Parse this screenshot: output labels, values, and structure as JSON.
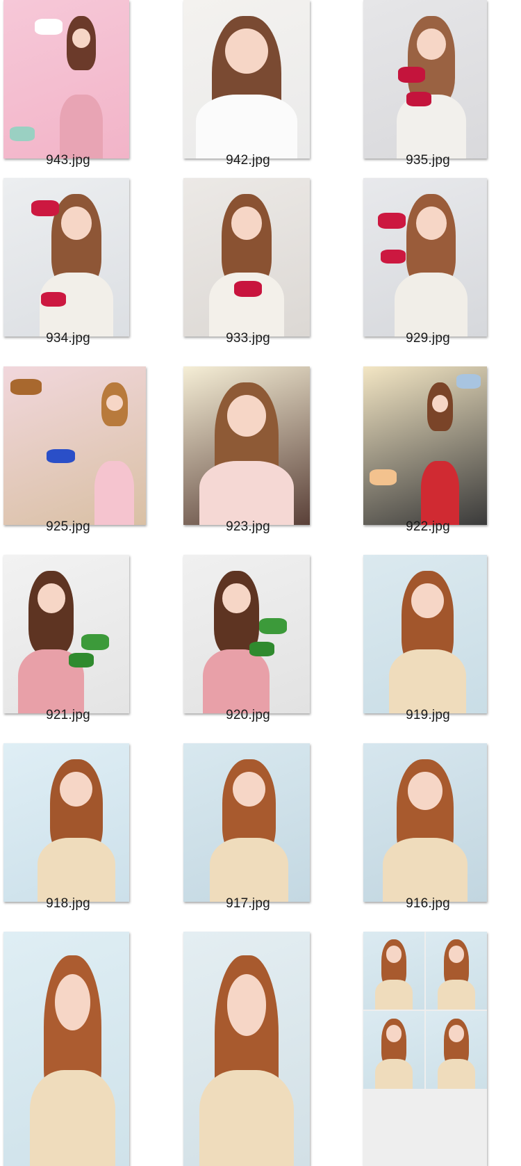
{
  "files": [
    {
      "name": "943.jpg",
      "icon": "photo-thumbnail-icon",
      "bg": "#f6c8d8",
      "bg2": "#f2b4c8",
      "hair": "#6b3a2a",
      "top": "#e8a4b4",
      "prop": "#ffffff",
      "prop2": "#9ad0c2"
    },
    {
      "name": "942.jpg",
      "icon": "photo-thumbnail-icon",
      "bg": "#f4f2ef",
      "bg2": "#eaeaea",
      "hair": "#7a4a32",
      "top": "#fbfbfb",
      "prop": "#f1d3c3",
      "prop2": "#f1d3c3"
    },
    {
      "name": "935.jpg",
      "icon": "photo-thumbnail-icon",
      "bg": "#e6e6e8",
      "bg2": "#d9d9dc",
      "hair": "#9a6242",
      "top": "#f2f0ec",
      "prop": "#c4143c",
      "prop2": "#c4143c"
    },
    {
      "name": "934.jpg",
      "icon": "photo-thumbnail-icon",
      "bg": "#eceef0",
      "bg2": "#dcdfe3",
      "hair": "#8e5636",
      "top": "#f2efe9",
      "prop": "#cc1840",
      "prop2": "#cc1840"
    },
    {
      "name": "933.jpg",
      "icon": "photo-thumbnail-icon",
      "bg": "#ece9e6",
      "bg2": "#dcd8d4",
      "hair": "#8a5232",
      "top": "#f3f0ea",
      "prop": "#c8143e",
      "prop2": "#c8143e"
    },
    {
      "name": "929.jpg",
      "icon": "photo-thumbnail-icon",
      "bg": "#e8e9ec",
      "bg2": "#d6d8dc",
      "hair": "#9a5c3a",
      "top": "#f1eee8",
      "prop": "#cc1840",
      "prop2": "#cc1840"
    },
    {
      "name": "925.jpg",
      "icon": "photo-thumbnail-icon",
      "bg": "#f1d7dc",
      "bg2": "#d9c0a4",
      "hair": "#b87a3c",
      "top": "#f5c4cf",
      "prop": "#a8682e",
      "prop2": "#2a4fc8"
    },
    {
      "name": "923.jpg",
      "icon": "photo-thumbnail-icon",
      "bg": "#f5eed6",
      "bg2": "#5a4038",
      "hair": "#8e5a36",
      "top": "#f5d8d4",
      "prop": "#f8e6e2",
      "prop2": "#f8e6e2"
    },
    {
      "name": "922.jpg",
      "icon": "photo-thumbnail-icon",
      "bg": "#f3e6c4",
      "bg2": "#3a3a3a",
      "hair": "#7a4428",
      "top": "#d02a32",
      "prop": "#f3c28e",
      "prop2": "#a8c4e0"
    },
    {
      "name": "921.jpg",
      "icon": "photo-thumbnail-icon",
      "bg": "#f2f2f2",
      "bg2": "#e4e4e4",
      "hair": "#5e3422",
      "top": "#e8a0a8",
      "prop": "#3c9a3a",
      "prop2": "#2f8a2e"
    },
    {
      "name": "920.jpg",
      "icon": "photo-thumbnail-icon",
      "bg": "#f0f0f0",
      "bg2": "#e2e2e2",
      "hair": "#5e3422",
      "top": "#e8a0a8",
      "prop": "#3c9a3a",
      "prop2": "#2f8a2e"
    },
    {
      "name": "919.jpg",
      "icon": "photo-thumbnail-icon",
      "bg": "#dbe9ef",
      "bg2": "#c9dde6",
      "hair": "#a2562c",
      "top": "#efdcbc",
      "prop": "#efdcbc",
      "prop2": "#efdcbc"
    },
    {
      "name": "918.jpg",
      "icon": "photo-thumbnail-icon",
      "bg": "#dfeef5",
      "bg2": "#cce0ea",
      "hair": "#a2562c",
      "top": "#efdcbc",
      "prop": "#efdcbc",
      "prop2": "#efdcbc"
    },
    {
      "name": "917.jpg",
      "icon": "photo-thumbnail-icon",
      "bg": "#d8e8ef",
      "bg2": "#c4d8e2",
      "hair": "#a85a2e",
      "top": "#efdcbc",
      "prop": "#efdcbc",
      "prop2": "#efdcbc"
    },
    {
      "name": "916.jpg",
      "icon": "photo-thumbnail-icon",
      "bg": "#d6e6ee",
      "bg2": "#c2d6e0",
      "hair": "#a85a2e",
      "top": "#efdcbc",
      "prop": "#efdcbc",
      "prop2": "#efdcbc"
    },
    {
      "name": "",
      "icon": "photo-thumbnail-icon",
      "bg": "#dfeef4",
      "bg2": "#cfe2ea",
      "hair": "#ac5c30",
      "top": "#efdcbc",
      "prop": "#efdcbc",
      "prop2": "#efdcbc"
    },
    {
      "name": "",
      "icon": "photo-thumbnail-icon",
      "bg": "#e4eef2",
      "bg2": "#d2e0e6",
      "hair": "#a85a2e",
      "top": "#efdcbc",
      "prop": "#efdcbc",
      "prop2": "#efdcbc"
    },
    {
      "name": "",
      "icon": "photo-collage-icon",
      "bg": "#dbeaf1",
      "bg2": "#cde0e8",
      "hair": "#a85a2e",
      "top": "#efdcbc",
      "prop": "#efdcbc",
      "prop2": "#efdcbc"
    }
  ]
}
